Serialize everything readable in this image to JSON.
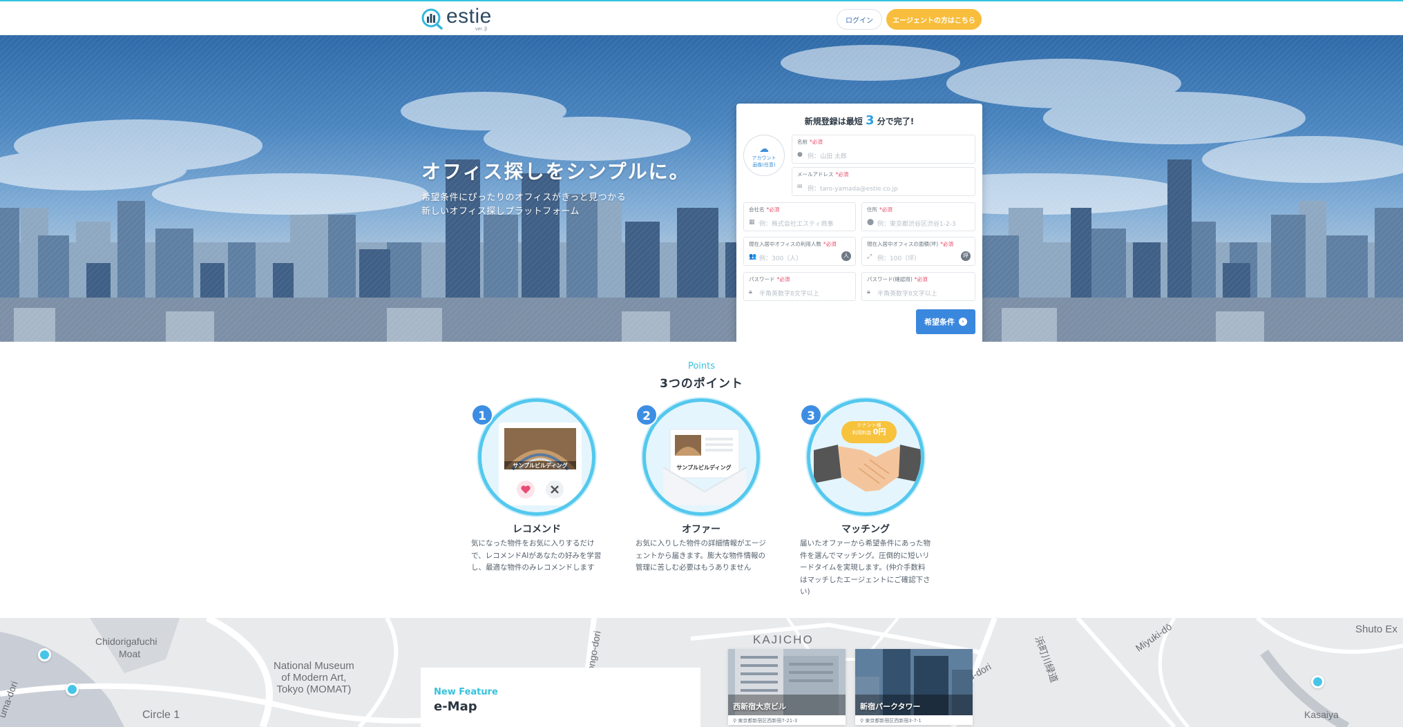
{
  "header": {
    "logo_text": "estie",
    "logo_version": "ver. β",
    "login_label": "ログイン",
    "agent_label": "エージェントの方はこちら"
  },
  "hero": {
    "title": "オフィス探しをシンプルに。",
    "subtitle_line1": "希望条件にぴったりのオフィスがきっと見つかる",
    "subtitle_line2": "新しいオフィス探しプラットフォーム"
  },
  "form": {
    "title_prefix": "新規登録は最短",
    "title_number": "3",
    "title_suffix": "分で完了!",
    "avatar_label_line1": "アカウント",
    "avatar_label_line2": "画像(任意)",
    "required_mark": "*必須",
    "fields": {
      "name": {
        "label": "名前",
        "placeholder": "例：山田 太郎"
      },
      "email": {
        "label": "メールアドレス",
        "placeholder": "例：taro-yamada@estie.co.jp"
      },
      "company": {
        "label": "会社名",
        "placeholder": "例：株式会社エスティ商事"
      },
      "address": {
        "label": "住所",
        "placeholder": "例：東京都渋谷区渋谷1-2-3"
      },
      "users": {
        "label": "現在入居中オフィスの利用人数",
        "placeholder": "例：300（人）"
      },
      "area": {
        "label": "現在入居中オフィスの面積(坪)",
        "placeholder": "例：100（坪）"
      },
      "password": {
        "label": "パスワード",
        "placeholder": "半角英数字8文字以上"
      },
      "password_confirm": {
        "label": "パスワード(確認用)",
        "placeholder": "半角英数字8文字以上"
      }
    },
    "submit_label": "希望条件"
  },
  "points": {
    "eyebrow": "Points",
    "title": "3つのポイント",
    "items": [
      {
        "number": "1",
        "name": "レコメンド",
        "description": "気になった物件をお気に入りするだけで、レコメンドAIがあなたの好みを学習し、最適な物件のみレコメンドします",
        "card_label": "サンプルビルディング"
      },
      {
        "number": "2",
        "name": "オファー",
        "description": "お気に入りした物件の詳細情報がエージェントから届きます。膨大な物件情報の管理に苦しむ必要はもうありません",
        "card_label": "サンプルビルディング"
      },
      {
        "number": "3",
        "name": "マッチング",
        "description": "届いたオファーから希望条件にあった物件を選んでマッチング。圧倒的に短いリードタイムを実現します。(仲介手数料はマッチしたエージェントにご確認下さい)",
        "bubble_line1": "テナント様",
        "bubble_line2": "利用料金",
        "bubble_value": "0円"
      }
    ]
  },
  "map": {
    "labels": {
      "chidorigafuchi": "Chidorigafuchi",
      "moat": "Moat",
      "museum_line1": "National Museum",
      "museum_line2": "of Modern Art,",
      "museum_line3": "Tokyo (MOMAT)",
      "circle1": "Circle 1",
      "kajicho": "KAJICHO",
      "ongo_dori": "ongo-dori",
      "uma_dori": "uma-dori",
      "hamacho": "浜町川緑道",
      "miyuki": "Miyuki-dō",
      "u_dori": "u-dori",
      "shuto": "Shuto Ex",
      "kasaiya": "Kasaiya"
    },
    "feature_eyebrow": "New Feature",
    "feature_title": "e-Map",
    "buildings": [
      {
        "name": "西新宿大京ビル",
        "address": "東京都新宿区西新宿7-21-3"
      },
      {
        "name": "新宿パークタワー",
        "address": "東京都新宿区西新宿3-7-1"
      }
    ]
  },
  "colors": {
    "accent": "#36c2dc",
    "primary_button": "#3a87de",
    "agent_button": "#f8bd3c",
    "required": "#e94765"
  }
}
